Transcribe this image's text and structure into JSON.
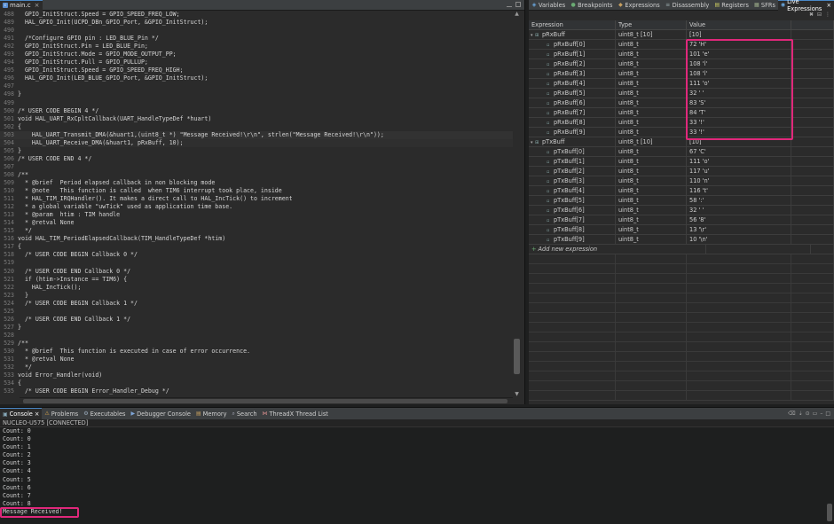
{
  "editor": {
    "tab_label": "main.c",
    "lines": [
      {
        "n": "488",
        "t": "  GPIO_InitStruct.Speed = GPIO_SPEED_FREQ_LOW;"
      },
      {
        "n": "489",
        "t": "  HAL_GPIO_Init(UCPD_DBn_GPIO_Port, &GPIO_InitStruct);"
      },
      {
        "n": "490",
        "t": ""
      },
      {
        "n": "491",
        "t": "  /*Configure GPIO pin : LED_BLUE_Pin */"
      },
      {
        "n": "492",
        "t": "  GPIO_InitStruct.Pin = LED_BLUE_Pin;"
      },
      {
        "n": "493",
        "t": "  GPIO_InitStruct.Mode = GPIO_MODE_OUTPUT_PP;"
      },
      {
        "n": "494",
        "t": "  GPIO_InitStruct.Pull = GPIO_PULLUP;"
      },
      {
        "n": "495",
        "t": "  GPIO_InitStruct.Speed = GPIO_SPEED_FREQ_HIGH;"
      },
      {
        "n": "496",
        "t": "  HAL_GPIO_Init(LED_BLUE_GPIO_Port, &GPIO_InitStruct);"
      },
      {
        "n": "497",
        "t": ""
      },
      {
        "n": "498",
        "t": "}"
      },
      {
        "n": "499",
        "t": ""
      },
      {
        "n": "500",
        "t": "/* USER CODE BEGIN 4 */"
      },
      {
        "n": "501",
        "t": "void HAL_UART_RxCpltCallback(UART_HandleTypeDef *huart)"
      },
      {
        "n": "502",
        "t": "{"
      },
      {
        "n": "503",
        "t": "    HAL_UART_Transmit_DMA(&huart1,(uint8_t *) \"Message Received!\\r\\n\", strlen(\"Message Received!\\r\\n\"));"
      },
      {
        "n": "504",
        "t": "    HAL_UART_Receive_DMA(&huart1, pRxBuff, 10);"
      },
      {
        "n": "505",
        "t": "}"
      },
      {
        "n": "506",
        "t": "/* USER CODE END 4 */"
      },
      {
        "n": "507",
        "t": ""
      },
      {
        "n": "508",
        "t": "/**"
      },
      {
        "n": "509",
        "t": "  * @brief  Period elapsed callback in non blocking mode"
      },
      {
        "n": "510",
        "t": "  * @note   This function is called  when TIM6 interrupt took place, inside"
      },
      {
        "n": "511",
        "t": "  * HAL_TIM_IRQHandler(). It makes a direct call to HAL_IncTick() to increment"
      },
      {
        "n": "512",
        "t": "  * a global variable \"uwTick\" used as application time base."
      },
      {
        "n": "513",
        "t": "  * @param  htim : TIM handle"
      },
      {
        "n": "514",
        "t": "  * @retval None"
      },
      {
        "n": "515",
        "t": "  */"
      },
      {
        "n": "516",
        "t": "void HAL_TIM_PeriodElapsedCallback(TIM_HandleTypeDef *htim)"
      },
      {
        "n": "517",
        "t": "{"
      },
      {
        "n": "518",
        "t": "  /* USER CODE BEGIN Callback 0 */"
      },
      {
        "n": "519",
        "t": ""
      },
      {
        "n": "520",
        "t": "  /* USER CODE END Callback 0 */"
      },
      {
        "n": "521",
        "t": "  if (htim->Instance == TIM6) {"
      },
      {
        "n": "522",
        "t": "    HAL_IncTick();"
      },
      {
        "n": "523",
        "t": "  }"
      },
      {
        "n": "524",
        "t": "  /* USER CODE BEGIN Callback 1 */"
      },
      {
        "n": "525",
        "t": ""
      },
      {
        "n": "526",
        "t": "  /* USER CODE END Callback 1 */"
      },
      {
        "n": "527",
        "t": "}"
      },
      {
        "n": "528",
        "t": ""
      },
      {
        "n": "529",
        "t": "/**"
      },
      {
        "n": "530",
        "t": "  * @brief  This function is executed in case of error occurrence."
      },
      {
        "n": "531",
        "t": "  * @retval None"
      },
      {
        "n": "532",
        "t": "  */"
      },
      {
        "n": "533",
        "t": "void Error_Handler(void)"
      },
      {
        "n": "534",
        "t": "{"
      },
      {
        "n": "535",
        "t": "  /* USER CODE BEGIN Error_Handler_Debug */"
      }
    ]
  },
  "right_panel": {
    "tabs": [
      {
        "label": "Variables",
        "icon": "variables-icon"
      },
      {
        "label": "Breakpoints",
        "icon": "breakpoints-icon"
      },
      {
        "label": "Expressions",
        "icon": "expressions-icon"
      },
      {
        "label": "Disassembly",
        "icon": "disassembly-icon"
      },
      {
        "label": "Registers",
        "icon": "registers-icon"
      },
      {
        "label": "SFRs",
        "icon": "sfrs-icon"
      },
      {
        "label": "Live Expressions",
        "icon": "live-expressions-icon",
        "active": true
      }
    ],
    "columns": {
      "expression": "Expression",
      "type": "Type",
      "value": "Value"
    },
    "groups": [
      {
        "name": "pRxBuff",
        "type": "uint8_t [10]",
        "value": "[10]",
        "rows": [
          {
            "name": "pRxBuff[0]",
            "type": "uint8_t",
            "value": "72 'H'"
          },
          {
            "name": "pRxBuff[1]",
            "type": "uint8_t",
            "value": "101 'e'"
          },
          {
            "name": "pRxBuff[2]",
            "type": "uint8_t",
            "value": "108 'l'"
          },
          {
            "name": "pRxBuff[3]",
            "type": "uint8_t",
            "value": "108 'l'"
          },
          {
            "name": "pRxBuff[4]",
            "type": "uint8_t",
            "value": "111 'o'"
          },
          {
            "name": "pRxBuff[5]",
            "type": "uint8_t",
            "value": "32 ' '"
          },
          {
            "name": "pRxBuff[6]",
            "type": "uint8_t",
            "value": "83 'S'"
          },
          {
            "name": "pRxBuff[7]",
            "type": "uint8_t",
            "value": "84 'T'"
          },
          {
            "name": "pRxBuff[8]",
            "type": "uint8_t",
            "value": "33 '!'"
          },
          {
            "name": "pRxBuff[9]",
            "type": "uint8_t",
            "value": "33 '!'"
          }
        ]
      },
      {
        "name": "pTxBuff",
        "type": "uint8_t [10]",
        "value": "[10]",
        "rows": [
          {
            "name": "pTxBuff[0]",
            "type": "uint8_t",
            "value": "67 'C'"
          },
          {
            "name": "pTxBuff[1]",
            "type": "uint8_t",
            "value": "111 'o'"
          },
          {
            "name": "pTxBuff[2]",
            "type": "uint8_t",
            "value": "117 'u'"
          },
          {
            "name": "pTxBuff[3]",
            "type": "uint8_t",
            "value": "110 'n'"
          },
          {
            "name": "pTxBuff[4]",
            "type": "uint8_t",
            "value": "116 't'"
          },
          {
            "name": "pTxBuff[5]",
            "type": "uint8_t",
            "value": "58 ':'"
          },
          {
            "name": "pTxBuff[6]",
            "type": "uint8_t",
            "value": "32 ' '"
          },
          {
            "name": "pTxBuff[7]",
            "type": "uint8_t",
            "value": "56 '8'"
          },
          {
            "name": "pTxBuff[8]",
            "type": "uint8_t",
            "value": "13 '\\r'"
          },
          {
            "name": "pTxBuff[9]",
            "type": "uint8_t",
            "value": "10 '\\n'"
          }
        ]
      }
    ],
    "add_expression": "Add new expression"
  },
  "console": {
    "tabs": [
      {
        "label": "Console",
        "icon": "console-icon",
        "active": true
      },
      {
        "label": "Problems",
        "icon": "problems-icon"
      },
      {
        "label": "Executables",
        "icon": "executables-icon"
      },
      {
        "label": "Debugger Console",
        "icon": "debugger-console-icon"
      },
      {
        "label": "Memory",
        "icon": "memory-icon"
      },
      {
        "label": "Search",
        "icon": "search-icon"
      },
      {
        "label": "ThreadX Thread List",
        "icon": "threadx-icon"
      }
    ],
    "status": "NUCLEO-U575 [CONNECTED]",
    "output": [
      "Count: 0",
      "Count: 0",
      "Count: 1",
      "Count: 2",
      "Count: 3",
      "Count: 4",
      "Count: 5",
      "Count: 6",
      "Count: 7",
      "Count: 8",
      "Message Received!"
    ]
  },
  "colors": {
    "highlight": "#e0287b",
    "accent": "#4a88c7"
  }
}
